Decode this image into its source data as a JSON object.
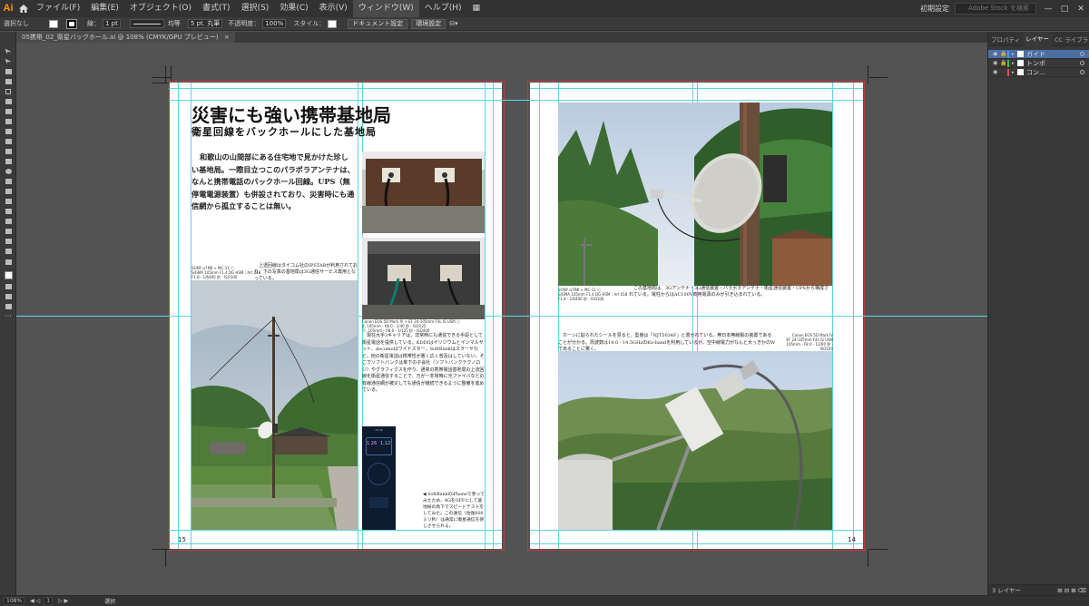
{
  "menubar": {
    "logo": "Ai",
    "items": [
      "ファイル(F)",
      "編集(E)",
      "オブジェクト(O)",
      "書式(T)",
      "選択(S)",
      "効果(C)",
      "表示(V)",
      "ウィンドウ(W)",
      "ヘルプ(H)"
    ],
    "active_index": 7,
    "workspace": "初期設定",
    "search_placeholder": "Adobe Stock を検索",
    "win_minimize": "—",
    "win_maximize": "□",
    "win_close": "✕"
  },
  "controlbar": {
    "selection": "選択なし",
    "stroke_label": "線：",
    "stroke_width": "1 pt",
    "stroke_profile": "均等",
    "brush": "5 pt. 丸筆",
    "opacity_label": "不透明度：",
    "opacity": "100%",
    "style_label": "スタイル：",
    "document_setup": "ドキュメント設定",
    "preferences": "環境設定"
  },
  "document_tab": {
    "label": "05携帯_02_衛星バックホール.ai @ 108% (CMYK/GPU プレビュー)",
    "close": "×"
  },
  "left_page": {
    "title": "災害にも強い携帯基地局",
    "subtitle": "衛星回線をバックホールにした基地局",
    "lead": "和歌山の山間部にある住宅地で見かけた珍しい基地局。一際目立つこのパラボラアンテナは、なんと携帯電話のバックホール回線。UPS（無停電電源装置）も併設されており、災害時にも通信網から孤立することは無い。",
    "caption1_lines": [
      "SONY α7RⅢ + MC-11 ⓒ",
      "SIGMA 105mm F1.4 DG HSM｜Art 018",
      "F1.8 - 1/6400 秒 - ISO100"
    ],
    "text1": "上透回線はタイコム社のIPSTARが利用されており、下の写真の基地局は3G通信サービス専用となっている。",
    "caption2_lines": [
      "Canon EOS 5D Mark Ⅳ + EF 24-105mm F4L IS USM ⓒ",
      "β: 105mm - f/8.0 - 1/40 秒 - ISO125",
      "下: 105mm - f/8.0 - 1/125 秒 - ISO400"
    ],
    "text2": "現在大手3キャリアは、非常時にも通信できる手段として衛星電話を提供している。KDDIはイリジウムとインマルサット、docomoはワイドスター、SoftBankはスラーヤなど。他の衛星電話は携帯性が悪く広く普及はしていない。そこでソフトバンクは傘下の子会社（ソフトバンクテクノロジ）やグラフィクスを作り、通常の携帯電話基地局の上流回線を衛星通信することで、万が一非常時に光ファイバなどの有線通信網が被災しても通信が継続できるように整備を進めている。",
    "phone_time": "15:36",
    "phone_speed1": "1.26",
    "phone_speed2": "1.12",
    "phone_caption": "◀ SoftBankのiPhoneで参ってみたため、4GをOFFにして基地局の真下でスピードテストをしてみた。この通信（往復600ミリ秒）は通常に衛星通信を感じさせられる。",
    "page_number": "15"
  },
  "right_page": {
    "caption1_lines": [
      "SONY α7RⅢ + MC-11 ⓒ",
      "SIGMA 105mm F1.4 DG HSM｜Art 018",
      "F1.8 - 1/6400 秒 - ISO100"
    ],
    "text1": "この基地局は、3Gアンテナ・3G通信装置・パラボラアンテナ・衛星通信装置・UPSから構成されている。電柱からはAC100V商用電源のみが引き込まれている。",
    "text2": "ホーンに貼られたシールを見ると、型番は「NJT5034F」と書かれている。無日本無線製の装置であることが分かる。周波数は14.0 - 14.5GHzのKu-bandを利用しているが、空中線電力がなんと大っきかのWであることに驚く。",
    "caption2_lines": [
      "Canon EOS 5D Mark Ⅳ",
      "EF 24-105mm F4L IS USM",
      "105mm - F8.0 - 1/200 秒 - ISO100"
    ],
    "page_number": "14"
  },
  "layers_panel": {
    "tabs": [
      "プロパティ",
      "レイヤー",
      "CC ライブラリ"
    ],
    "active_tab": 1,
    "layers": [
      {
        "name": "ガイド",
        "color": "#4f8ef7",
        "selected": true
      },
      {
        "name": "トンボ",
        "color": "#32c83c",
        "selected": false
      },
      {
        "name": "コン...",
        "color": "#e64b4b",
        "selected": false
      }
    ],
    "footer": "3 レイヤー"
  },
  "statusbar": {
    "zoom": "108%",
    "artboard": "1",
    "mode": "選択"
  }
}
